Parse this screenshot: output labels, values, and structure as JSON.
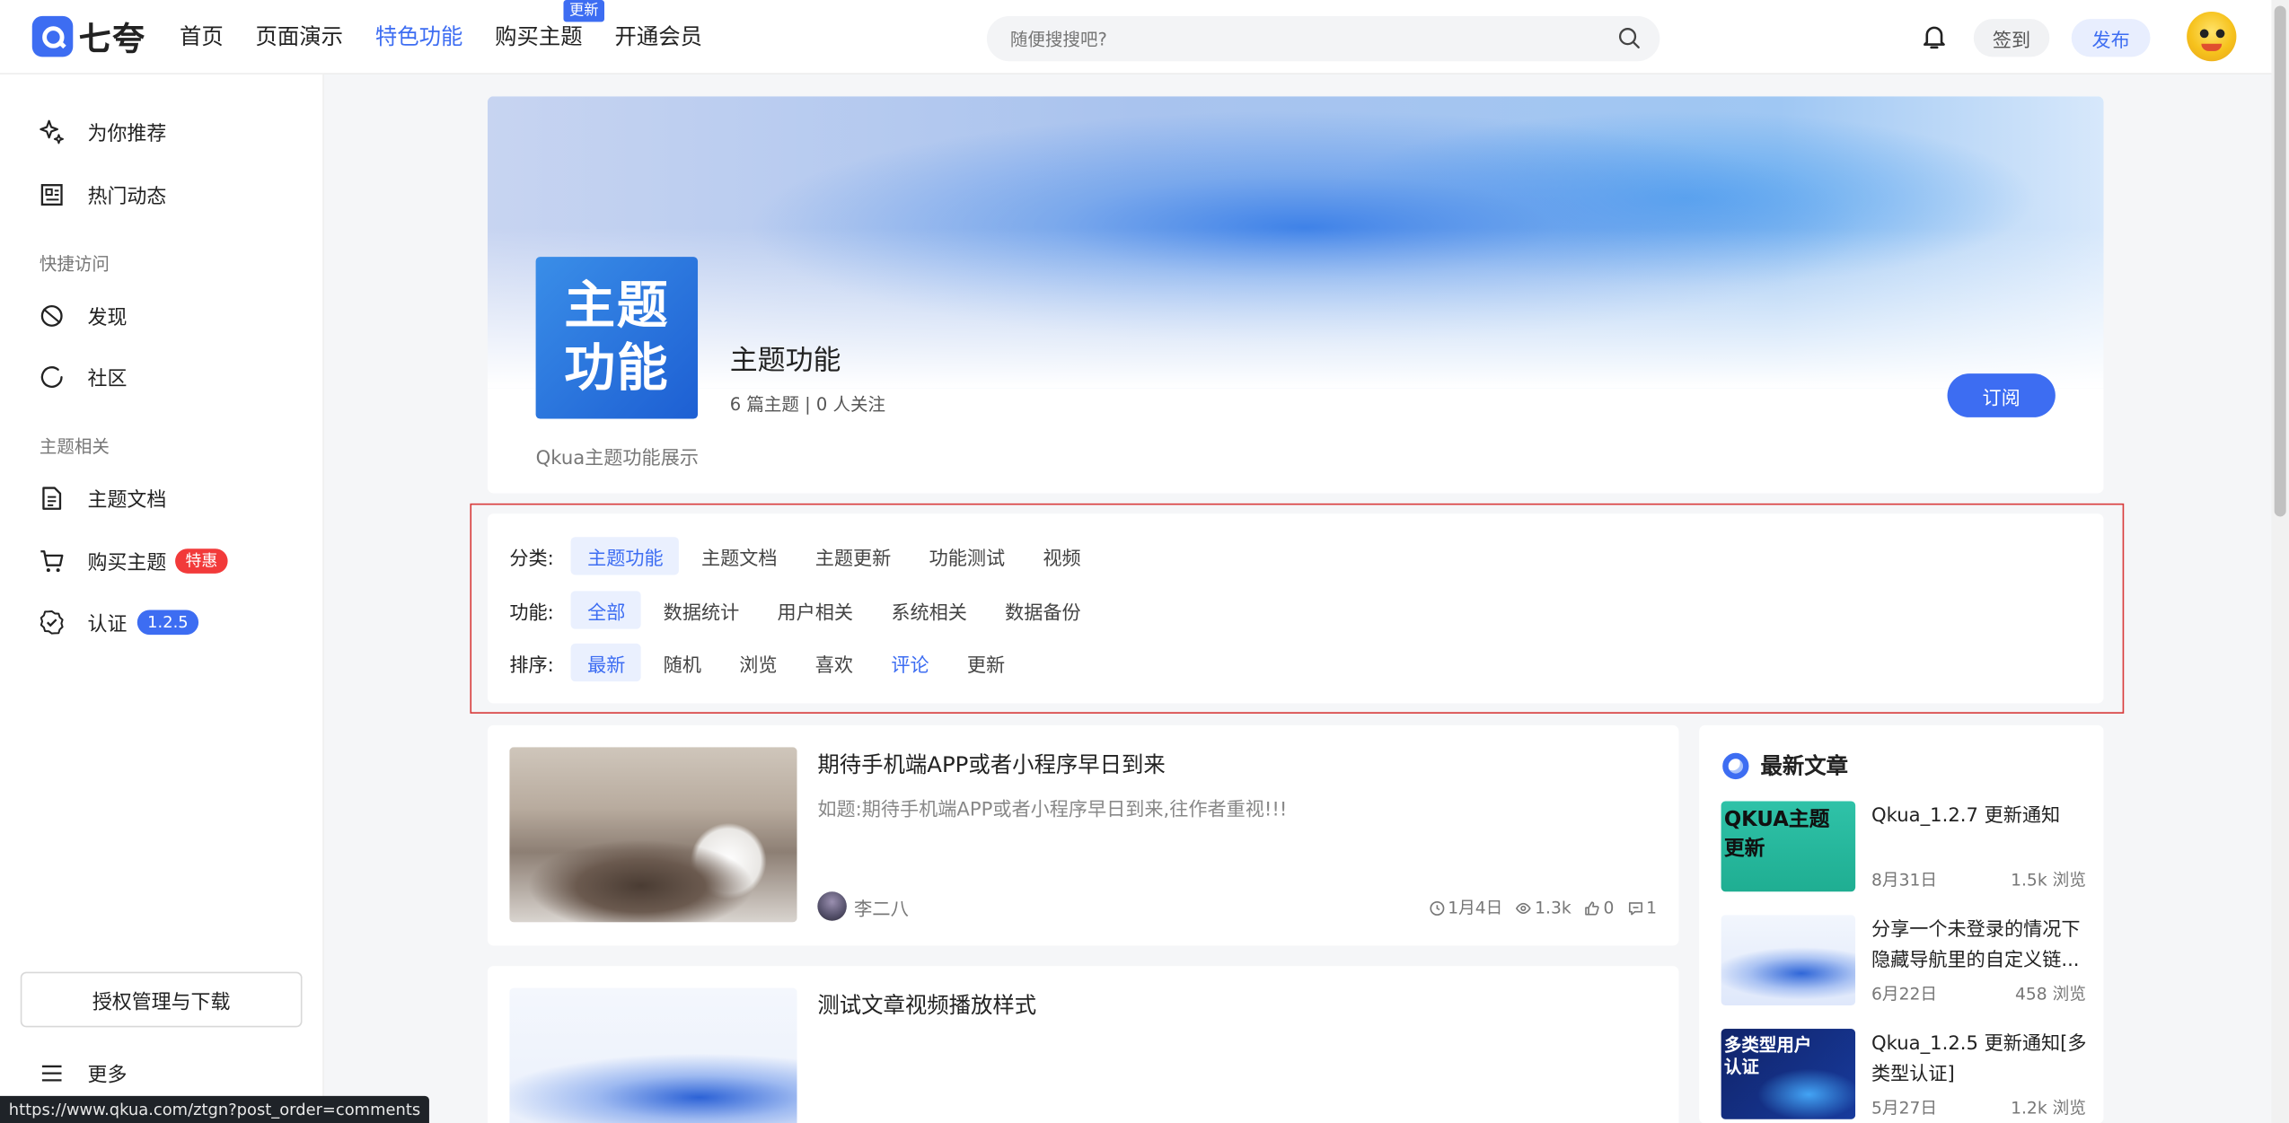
{
  "brand": {
    "name": "七夸",
    "accent": "#3d6df2"
  },
  "nav": {
    "items": [
      {
        "label": "首页"
      },
      {
        "label": "页面演示"
      },
      {
        "label": "特色功能"
      },
      {
        "label": "购买主题"
      },
      {
        "label": "开通会员"
      }
    ],
    "active_index": 2,
    "update_badge": "更新"
  },
  "search": {
    "placeholder": "随便搜搜吧?"
  },
  "header_actions": {
    "signin": "签到",
    "publish": "发布"
  },
  "sidebar": {
    "items": [
      {
        "label": "为你推荐",
        "icon": "sparkle-icon"
      },
      {
        "label": "热门动态",
        "icon": "news-icon"
      }
    ],
    "group_quick": "快捷访问",
    "quick_items": [
      {
        "label": "发现",
        "icon": "compass-icon"
      },
      {
        "label": "社区",
        "icon": "circle-icon"
      }
    ],
    "group_theme": "主题相关",
    "theme_items": [
      {
        "label": "主题文档",
        "icon": "document-icon"
      },
      {
        "label": "购买主题",
        "icon": "cart-icon",
        "tag": "特惠"
      },
      {
        "label": "认证",
        "icon": "verified-icon",
        "tag": "1.2.5"
      }
    ],
    "license_button": "授权管理与下载",
    "more": "更多"
  },
  "status_url": "https://www.qkua.com/ztgn?post_order=comments",
  "category": {
    "icon_line1": "主题",
    "icon_line2": "功能",
    "title": "主题功能",
    "meta": "6 篇主题 | 0 人关注",
    "description": "Qkua主题功能展示",
    "subscribe": "订阅"
  },
  "filters": {
    "category": {
      "label": "分类:",
      "options": [
        "主题功能",
        "主题文档",
        "主题更新",
        "功能测试",
        "视频"
      ],
      "selected": 0
    },
    "function": {
      "label": "功能:",
      "options": [
        "全部",
        "数据统计",
        "用户相关",
        "系统相关",
        "数据备份"
      ],
      "selected": 0
    },
    "order": {
      "label": "排序:",
      "options": [
        "最新",
        "随机",
        "浏览",
        "喜欢",
        "评论",
        "更新"
      ],
      "selected": 0,
      "hover": 4
    }
  },
  "posts": [
    {
      "title": "期待手机端APP或者小程序早日到来",
      "excerpt": "如题:期待手机端APP或者小程序早日到来,往作者重视!!!",
      "author": "李二八",
      "date": "1月4日",
      "views": "1.3k",
      "likes": "0",
      "comments": "1"
    },
    {
      "title": "测试文章视频播放样式"
    }
  ],
  "latest": {
    "title": "最新文章",
    "articles": [
      {
        "title": "Qkua_1.2.7 更新通知",
        "date": "8月31日",
        "views": "1.5k 浏览",
        "thumb_text": "QKUA主题\n更新"
      },
      {
        "title": "分享一个未登录的情况下隐藏导航里的自定义链...",
        "date": "6月22日",
        "views": "458 浏览"
      },
      {
        "title": "Qkua_1.2.5 更新通知[多类型认证]",
        "date": "5月27日",
        "views": "1.2k 浏览",
        "thumb_text": "多类型用户\n认证"
      }
    ]
  }
}
